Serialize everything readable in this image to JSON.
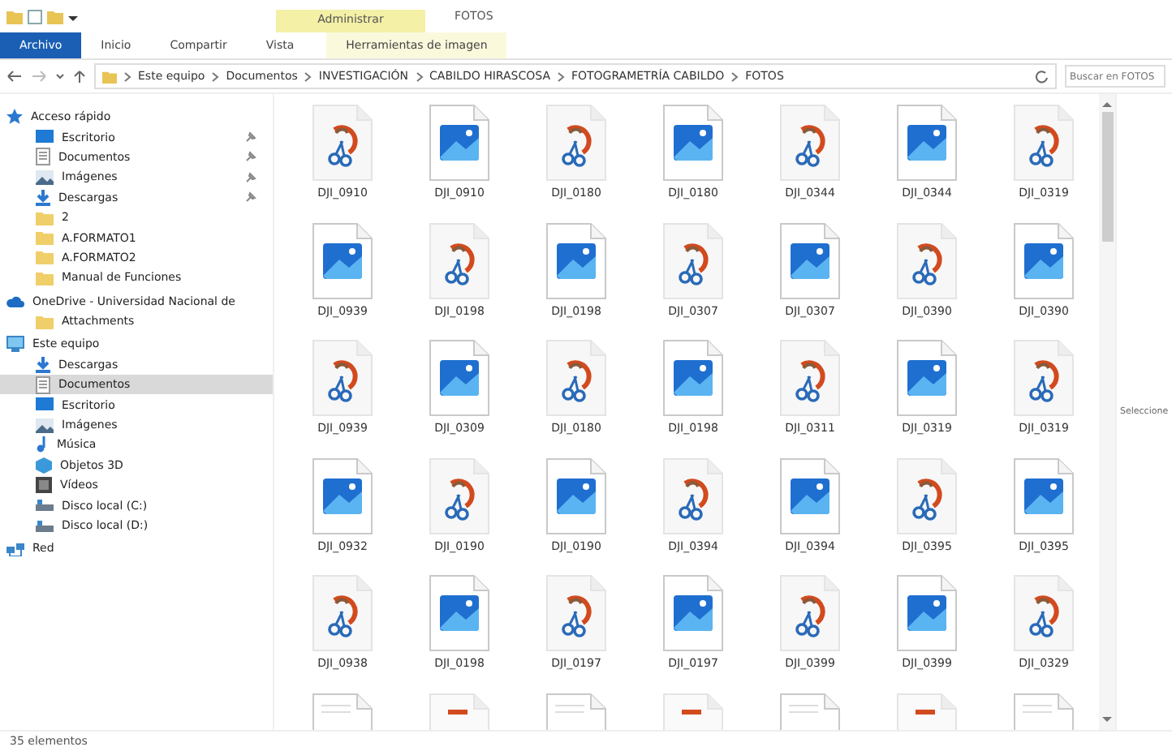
{
  "window": {
    "context_tab": "Administrar",
    "title": "FOTOS"
  },
  "ribbon_tabs": [
    {
      "label": "Archivo",
      "selected": true
    },
    {
      "label": "Inicio",
      "selected": false
    },
    {
      "label": "Compartir",
      "selected": false
    },
    {
      "label": "Vista",
      "selected": false
    },
    {
      "label": "Herramientas de imagen",
      "selected": false
    }
  ],
  "address": {
    "path": [
      "Este equipo",
      "Documentos",
      "INVESTIGACIÓN",
      "CABILDO HIRASCOSA",
      "FOTOGRAMETRÍA CABILDO",
      "FOTOS"
    ],
    "search_placeholder": "Buscar en FOTOS"
  },
  "sidebar": [
    {
      "label": "Acceso rápido",
      "kind": "star",
      "selected": false,
      "children": [
        {
          "label": "Escritorio",
          "kind": "desktop",
          "pinned": true,
          "selected": false
        },
        {
          "label": "Documentos",
          "kind": "docs",
          "pinned": true,
          "selected": false
        },
        {
          "label": "Imágenes",
          "kind": "pictures",
          "pinned": true,
          "selected": false
        },
        {
          "label": "Descargas",
          "kind": "download",
          "pinned": true,
          "selected": false
        },
        {
          "label": "2",
          "kind": "folder",
          "pinned": false,
          "selected": false
        },
        {
          "label": "A.FORMATO1",
          "kind": "folder",
          "pinned": false,
          "selected": false
        },
        {
          "label": "A.FORMATO2",
          "kind": "folder",
          "pinned": false,
          "selected": false
        },
        {
          "label": "Manual de Funciones",
          "kind": "folder",
          "pinned": false,
          "selected": false
        }
      ]
    },
    {
      "label": "OneDrive - Universidad Nacional de",
      "kind": "cloud",
      "selected": false,
      "children": [
        {
          "label": "Attachments",
          "kind": "folder",
          "pinned": false,
          "selected": false
        }
      ]
    },
    {
      "label": "Este equipo",
      "kind": "computer",
      "selected": false,
      "children": [
        {
          "label": "Descargas",
          "kind": "download",
          "pinned": false,
          "selected": false
        },
        {
          "label": "Documentos",
          "kind": "docs",
          "pinned": false,
          "selected": true
        },
        {
          "label": "Escritorio",
          "kind": "desktop",
          "pinned": false,
          "selected": false
        },
        {
          "label": "Imágenes",
          "kind": "pictures",
          "pinned": false,
          "selected": false
        },
        {
          "label": "Música",
          "kind": "music",
          "pinned": false,
          "selected": false
        },
        {
          "label": "Objetos 3D",
          "kind": "objects3d",
          "pinned": false,
          "selected": false
        },
        {
          "label": "Vídeos",
          "kind": "videos",
          "pinned": false,
          "selected": false
        },
        {
          "label": "Disco local (C:)",
          "kind": "drive",
          "pinned": false,
          "selected": false
        },
        {
          "label": "Disco local (D:)",
          "kind": "drive",
          "pinned": false,
          "selected": false
        }
      ]
    },
    {
      "label": "Red",
      "kind": "network",
      "selected": false
    }
  ],
  "files": [
    {
      "name": "DJI_0910",
      "kind": "paint"
    },
    {
      "name": "DJI_0910",
      "kind": "image"
    },
    {
      "name": "DJI_0180",
      "kind": "paint"
    },
    {
      "name": "DJI_0180",
      "kind": "image"
    },
    {
      "name": "DJI_0344",
      "kind": "paint"
    },
    {
      "name": "DJI_0344",
      "kind": "image"
    },
    {
      "name": "DJI_0319",
      "kind": "paint"
    },
    {
      "name": "DJI_0939",
      "kind": "image"
    },
    {
      "name": "DJI_0198",
      "kind": "paint"
    },
    {
      "name": "DJI_0198",
      "kind": "image"
    },
    {
      "name": "DJI_0307",
      "kind": "paint"
    },
    {
      "name": "DJI_0307",
      "kind": "image"
    },
    {
      "name": "DJI_0390",
      "kind": "paint"
    },
    {
      "name": "DJI_0390",
      "kind": "image"
    },
    {
      "name": "DJI_0939",
      "kind": "paint"
    },
    {
      "name": "DJI_0309",
      "kind": "image"
    },
    {
      "name": "DJI_0180",
      "kind": "paint"
    },
    {
      "name": "DJI_0198",
      "kind": "image"
    },
    {
      "name": "DJI_0311",
      "kind": "paint"
    },
    {
      "name": "DJI_0319",
      "kind": "image"
    },
    {
      "name": "DJI_0319",
      "kind": "paint"
    },
    {
      "name": "DJI_0932",
      "kind": "image"
    },
    {
      "name": "DJI_0190",
      "kind": "paint"
    },
    {
      "name": "DJI_0190",
      "kind": "image"
    },
    {
      "name": "DJI_0394",
      "kind": "paint"
    },
    {
      "name": "DJI_0394",
      "kind": "image"
    },
    {
      "name": "DJI_0395",
      "kind": "paint"
    },
    {
      "name": "DJI_0395",
      "kind": "image"
    },
    {
      "name": "DJI_0938",
      "kind": "paint"
    },
    {
      "name": "DJI_0198",
      "kind": "image"
    },
    {
      "name": "DJI_0197",
      "kind": "paint"
    },
    {
      "name": "DJI_0197",
      "kind": "image"
    },
    {
      "name": "DJI_0399",
      "kind": "paint"
    },
    {
      "name": "DJI_0399",
      "kind": "image"
    },
    {
      "name": "DJI_0329",
      "kind": "paint"
    },
    {
      "kind": "text"
    },
    {
      "kind": "photo"
    },
    {
      "kind": "text"
    },
    {
      "kind": "photo"
    },
    {
      "kind": "text"
    },
    {
      "kind": "photo"
    },
    {
      "kind": "text"
    }
  ],
  "preview_pane": {
    "text": "Seleccione"
  },
  "status_bar": {
    "count": "35 elementos"
  }
}
